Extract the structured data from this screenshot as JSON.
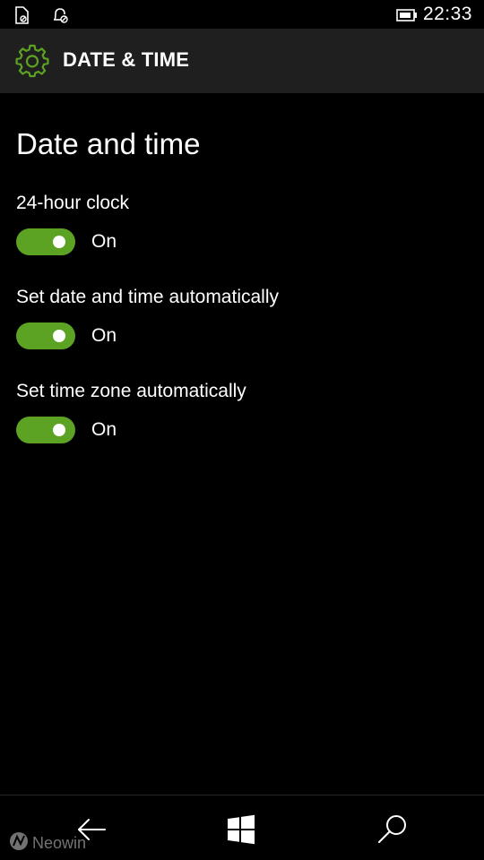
{
  "status_bar": {
    "time": "22:33",
    "icons": [
      "sim-card-icon",
      "notification-bell-icon",
      "battery-icon"
    ]
  },
  "header": {
    "icon": "gear-icon",
    "title": "DATE & TIME"
  },
  "page": {
    "title": "Date and time",
    "settings": [
      {
        "label": "24-hour clock",
        "state": "On",
        "enabled": true
      },
      {
        "label": "Set date and time automatically",
        "state": "On",
        "enabled": true
      },
      {
        "label": "Set time zone automatically",
        "state": "On",
        "enabled": true
      }
    ]
  },
  "nav": {
    "icons": [
      "back-arrow-icon",
      "windows-start-icon",
      "search-icon"
    ]
  },
  "watermark": {
    "text": "Neowin"
  },
  "colors": {
    "accent": "#5da323",
    "background": "#000000",
    "header_background": "#1f1f1f",
    "text": "#ffffff"
  }
}
